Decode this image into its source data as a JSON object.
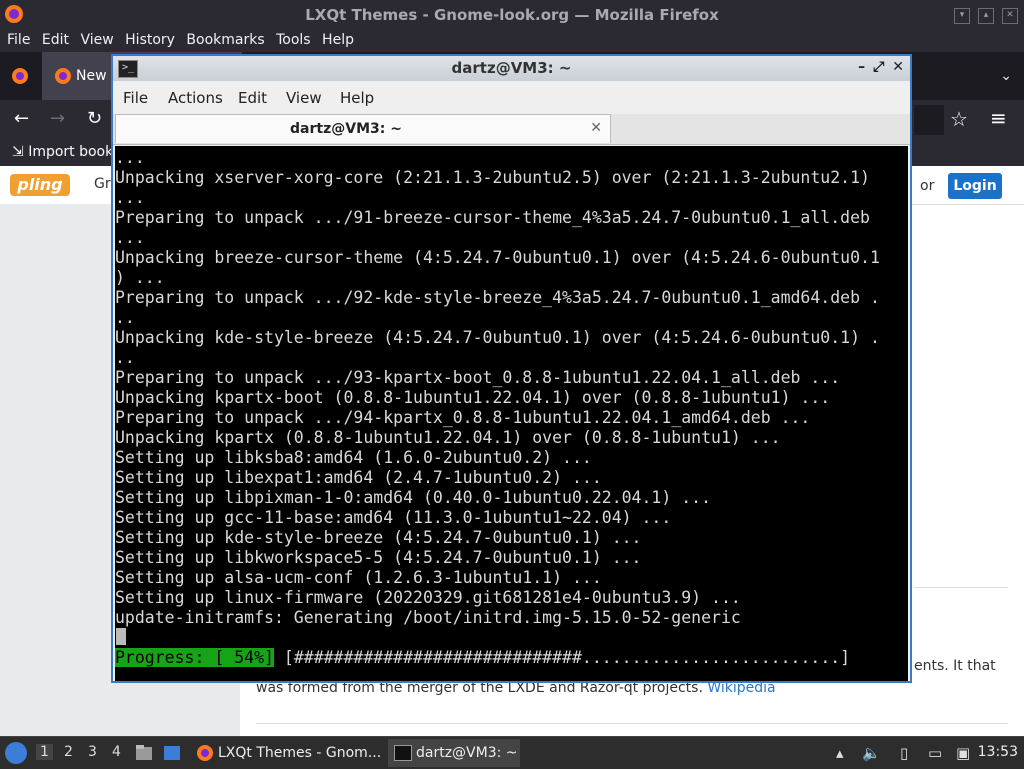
{
  "firefox": {
    "title": "LXQt Themes - Gnome-look.org — Mozilla Firefox",
    "menu": [
      "File",
      "Edit",
      "View",
      "History",
      "Bookmarks",
      "Tools",
      "Help"
    ],
    "tab_label": "New",
    "bookmarks_item": "Import book"
  },
  "page": {
    "logo": "pling",
    "header_fragment": "Gr",
    "or_text": "or",
    "login": "Login",
    "desc_right": "ents. It that",
    "desc_left": "was formed from the merger of the LXDE and Razor-qt projects.",
    "desc_link": "Wikipedia"
  },
  "terminal": {
    "title": "dartz@VM3: ~",
    "menu": [
      "File",
      "Actions",
      "Edit",
      "View",
      "Help"
    ],
    "tab_title": "dartz@VM3: ~",
    "lines": [
      "...",
      "Unpacking xserver-xorg-core (2:21.1.3-2ubuntu2.5) over (2:21.1.3-2ubuntu2.1)",
      "...",
      "Preparing to unpack .../91-breeze-cursor-theme_4%3a5.24.7-0ubuntu0.1_all.deb",
      "...",
      "Unpacking breeze-cursor-theme (4:5.24.7-0ubuntu0.1) over (4:5.24.6-0ubuntu0.1",
      ") ...",
      "Preparing to unpack .../92-kde-style-breeze_4%3a5.24.7-0ubuntu0.1_amd64.deb .",
      "..",
      "Unpacking kde-style-breeze (4:5.24.7-0ubuntu0.1) over (4:5.24.6-0ubuntu0.1) .",
      "..",
      "Preparing to unpack .../93-kpartx-boot_0.8.8-1ubuntu1.22.04.1_all.deb ...",
      "Unpacking kpartx-boot (0.8.8-1ubuntu1.22.04.1) over (0.8.8-1ubuntu1) ...",
      "Preparing to unpack .../94-kpartx_0.8.8-1ubuntu1.22.04.1_amd64.deb ...",
      "Unpacking kpartx (0.8.8-1ubuntu1.22.04.1) over (0.8.8-1ubuntu1) ...",
      "Setting up libksba8:amd64 (1.6.0-2ubuntu0.2) ...",
      "Setting up libexpat1:amd64 (2.4.7-1ubuntu0.2) ...",
      "Setting up libpixman-1-0:amd64 (0.40.0-1ubuntu0.22.04.1) ...",
      "Setting up gcc-11-base:amd64 (11.3.0-1ubuntu1~22.04) ...",
      "Setting up kde-style-breeze (4:5.24.7-0ubuntu0.1) ...",
      "Setting up libkworkspace5-5 (4:5.24.7-0ubuntu0.1) ...",
      "Setting up alsa-ucm-conf (1.2.6.3-1ubuntu1.1) ...",
      "Setting up linux-firmware (20220329.git681281e4-0ubuntu3.9) ...",
      "update-initramfs: Generating /boot/initrd.img-5.15.0-52-generic"
    ],
    "progress_label": "Progress: [ 54%]",
    "progress_bar": " [#############################..........................]",
    "progress_percent": 54
  },
  "taskbar": {
    "desktops": [
      "1",
      "2",
      "3",
      "4"
    ],
    "tasks": [
      "LXQt Themes - Gnom...",
      "dartz@VM3: ~"
    ],
    "clock": "13:53"
  }
}
